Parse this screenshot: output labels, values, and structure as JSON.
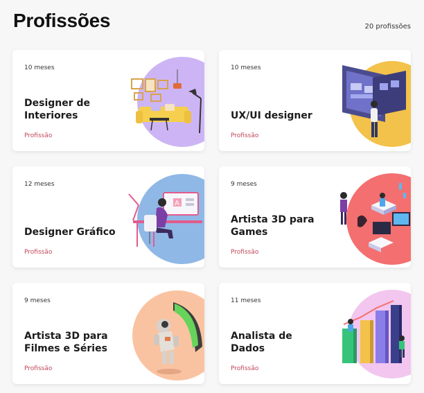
{
  "page": {
    "title": "Profissões",
    "count": "20 profissões"
  },
  "cards": [
    {
      "duration": "10 meses",
      "title": "Designer de Interiores",
      "tag": "Profissão",
      "circle_color": "#cdb5f5"
    },
    {
      "duration": "10 meses",
      "title": "UX/UI designer",
      "tag": "Profissão",
      "circle_color": "#f3c24a"
    },
    {
      "duration": "12 meses",
      "title": "Designer Gráfico",
      "tag": "Profissão",
      "circle_color": "#8fb8e6"
    },
    {
      "duration": "9 meses",
      "title": "Artista 3D para Games",
      "tag": "Profissão",
      "circle_color": "#f46f6f"
    },
    {
      "duration": "9 meses",
      "title": "Artista 3D para Filmes e Séries",
      "tag": "Profissão",
      "circle_color": "#f9c3a1"
    },
    {
      "duration": "11 meses",
      "title": "Analista de Dados",
      "tag": "Profissão",
      "circle_color": "#f2c6ef"
    }
  ],
  "illustrations": [
    "interior-design-illustration",
    "ux-ui-illustration",
    "graphic-design-illustration",
    "3d-games-illustration",
    "3d-films-illustration",
    "data-analyst-illustration"
  ],
  "colors": {
    "tag": "#c2475a",
    "background": "#f7f7f8"
  }
}
